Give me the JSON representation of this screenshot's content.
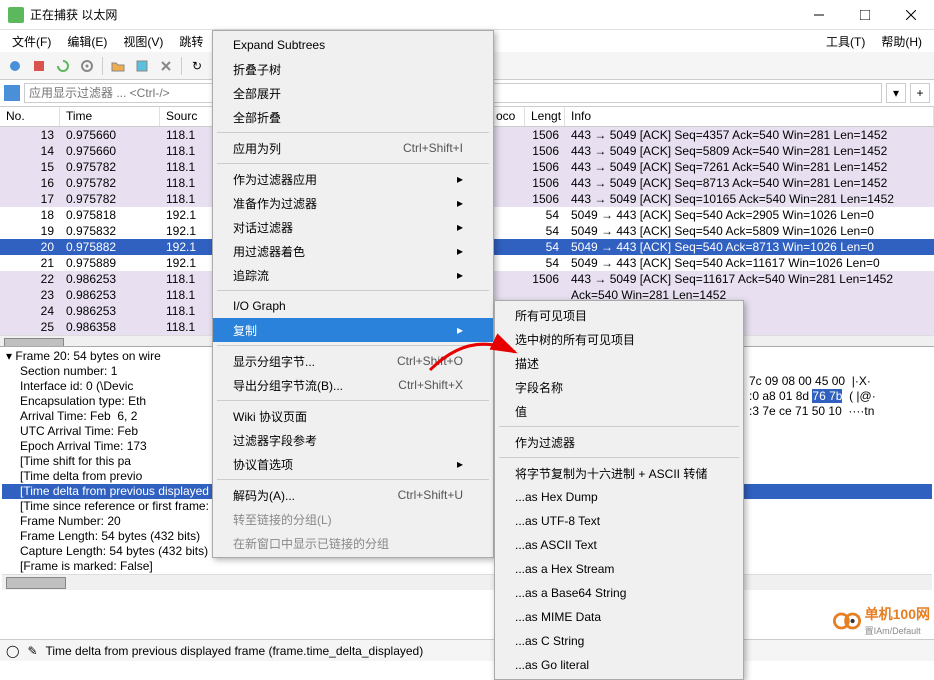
{
  "title": "正在捕获 以太网",
  "menu": [
    "文件(F)",
    "编辑(E)",
    "视图(V)",
    "跳转",
    "",
    "",
    "",
    "工具(T)",
    "帮助(H)"
  ],
  "filter_placeholder": "应用显示过滤器 ... <Ctrl-/>",
  "columns": {
    "no": "No.",
    "time": "Time",
    "src": "Sourc",
    "proto": "oco",
    "len": "Lengt",
    "info": "Info"
  },
  "packets": [
    {
      "no": "13",
      "time": "0.975660",
      "src": "118.1",
      "len": "1506",
      "info": "443 → 5049 [ACK] Seq=4357 Ack=540 Win=281 Len=1452",
      "cls": "purple"
    },
    {
      "no": "14",
      "time": "0.975660",
      "src": "118.1",
      "len": "1506",
      "info": "443 → 5049 [ACK] Seq=5809 Ack=540 Win=281 Len=1452",
      "cls": "purple"
    },
    {
      "no": "15",
      "time": "0.975782",
      "src": "118.1",
      "len": "1506",
      "info": "443 → 5049 [ACK] Seq=7261 Ack=540 Win=281 Len=1452",
      "cls": "purple"
    },
    {
      "no": "16",
      "time": "0.975782",
      "src": "118.1",
      "len": "1506",
      "info": "443 → 5049 [ACK] Seq=8713 Ack=540 Win=281 Len=1452",
      "cls": "purple"
    },
    {
      "no": "17",
      "time": "0.975782",
      "src": "118.1",
      "len": "1506",
      "info": "443 → 5049 [ACK] Seq=10165 Ack=540 Win=281 Len=1452",
      "cls": "purple"
    },
    {
      "no": "18",
      "time": "0.975818",
      "src": "192.1",
      "len": "54",
      "info": "5049 → 443 [ACK] Seq=540 Ack=2905 Win=1026 Len=0",
      "cls": ""
    },
    {
      "no": "19",
      "time": "0.975832",
      "src": "192.1",
      "len": "54",
      "info": "5049 → 443 [ACK] Seq=540 Ack=5809 Win=1026 Len=0",
      "cls": ""
    },
    {
      "no": "20",
      "time": "0.975882",
      "src": "192.1",
      "len": "54",
      "info": "5049 → 443 [ACK] Seq=540 Ack=8713 Win=1026 Len=0",
      "cls": "sel"
    },
    {
      "no": "21",
      "time": "0.975889",
      "src": "192.1",
      "len": "54",
      "info": "5049 → 443 [ACK] Seq=540 Ack=11617 Win=1026 Len=0",
      "cls": ""
    },
    {
      "no": "22",
      "time": "0.986253",
      "src": "118.1",
      "len": "1506",
      "info": "443 → 5049 [ACK] Seq=11617 Ack=540 Win=281 Len=1452",
      "cls": "purple"
    },
    {
      "no": "23",
      "time": "0.986253",
      "src": "118.1",
      "len": "",
      "info": "               Ack=540 Win=281 Len=1452",
      "cls": "purple"
    },
    {
      "no": "24",
      "time": "0.986253",
      "src": "118.1",
      "len": "",
      "info": "               Ack=540 Win=281 Len=1452",
      "cls": "purple"
    },
    {
      "no": "25",
      "time": "0.986358",
      "src": "118.1",
      "len": "",
      "info": "",
      "cls": "purple"
    }
  ],
  "details": [
    {
      "t": "Frame 20: 54 bytes on wire",
      "tree": true
    },
    {
      "t": "Section number: 1"
    },
    {
      "t": "Interface id: 0 (\\Devic"
    },
    {
      "t": "Encapsulation type: Eth"
    },
    {
      "t": "Arrival Time: Feb  6, 2"
    },
    {
      "t": "UTC Arrival Time: Feb"
    },
    {
      "t": "Epoch Arrival Time: 173"
    },
    {
      "t": "[Time shift for this pa"
    },
    {
      "t": "[Time delta from previo"
    },
    {
      "t": "[Time delta from previous displayed frame: 0.000050000 se",
      "hl": true
    },
    {
      "t": "[Time since reference or first frame: 0.975882000 seconds"
    },
    {
      "t": "Frame Number: 20"
    },
    {
      "t": "Frame Length: 54 bytes (432 bits)"
    },
    {
      "t": "Capture Length: 54 bytes (432 bits)"
    },
    {
      "t": "[Frame is marked: False]"
    }
  ],
  "hex": [
    {
      "a": "7c 09 08 00 45 00",
      "b": "|·X·"
    },
    {
      "a": ":0 a8 01 8d ",
      "b": "( |@·",
      "hl": "76 7b"
    },
    {
      "a": ":3 7e ce 71 50 10",
      "b": "····tn"
    }
  ],
  "ctx1": [
    {
      "t": "Expand Subtrees"
    },
    {
      "t": "折叠子树"
    },
    {
      "t": "全部展开"
    },
    {
      "t": "全部折叠"
    },
    {
      "sep": true
    },
    {
      "t": "应用为列",
      "s": "Ctrl+Shift+I"
    },
    {
      "sep": true
    },
    {
      "t": "作为过滤器应用",
      "sub": true
    },
    {
      "t": "准备作为过滤器",
      "sub": true
    },
    {
      "t": "对话过滤器",
      "sub": true
    },
    {
      "t": "用过滤器着色",
      "sub": true
    },
    {
      "t": "追踪流",
      "sub": true
    },
    {
      "sep": true
    },
    {
      "t": "I/O Graph"
    },
    {
      "t": "复制",
      "sub": true,
      "hl": true
    },
    {
      "sep": true
    },
    {
      "t": "显示分组字节...",
      "s": "Ctrl+Shift+O"
    },
    {
      "t": "导出分组字节流(B)...",
      "s": "Ctrl+Shift+X"
    },
    {
      "sep": true
    },
    {
      "t": "Wiki 协议页面"
    },
    {
      "t": "过滤器字段参考"
    },
    {
      "t": "协议首选项",
      "sub": true
    },
    {
      "sep": true
    },
    {
      "t": "解码为(A)...",
      "s": "Ctrl+Shift+U"
    },
    {
      "t": "转至链接的分组(L)",
      "dis": true
    },
    {
      "t": "在新窗口中显示已链接的分组",
      "dis": true
    }
  ],
  "ctx2": [
    {
      "t": "所有可见项目"
    },
    {
      "t": "选中树的所有可见项目"
    },
    {
      "t": "描述"
    },
    {
      "t": "字段名称"
    },
    {
      "t": "值"
    },
    {
      "sep": true
    },
    {
      "t": "作为过滤器"
    },
    {
      "sep": true
    },
    {
      "t": "将字节复制为十六进制 + ASCII 转储"
    },
    {
      "t": "...as Hex Dump"
    },
    {
      "t": "...as UTF-8 Text"
    },
    {
      "t": "...as ASCII Text"
    },
    {
      "t": "...as a Hex Stream"
    },
    {
      "t": "...as a Base64 String"
    },
    {
      "t": "...as MIME Data"
    },
    {
      "t": "...as C String"
    },
    {
      "t": "...as Go literal"
    }
  ],
  "status": "Time delta from previous displayed frame (frame.time_delta_displayed)",
  "watermark": {
    "name": "单机100网",
    "sub": "置IAm/Default"
  }
}
